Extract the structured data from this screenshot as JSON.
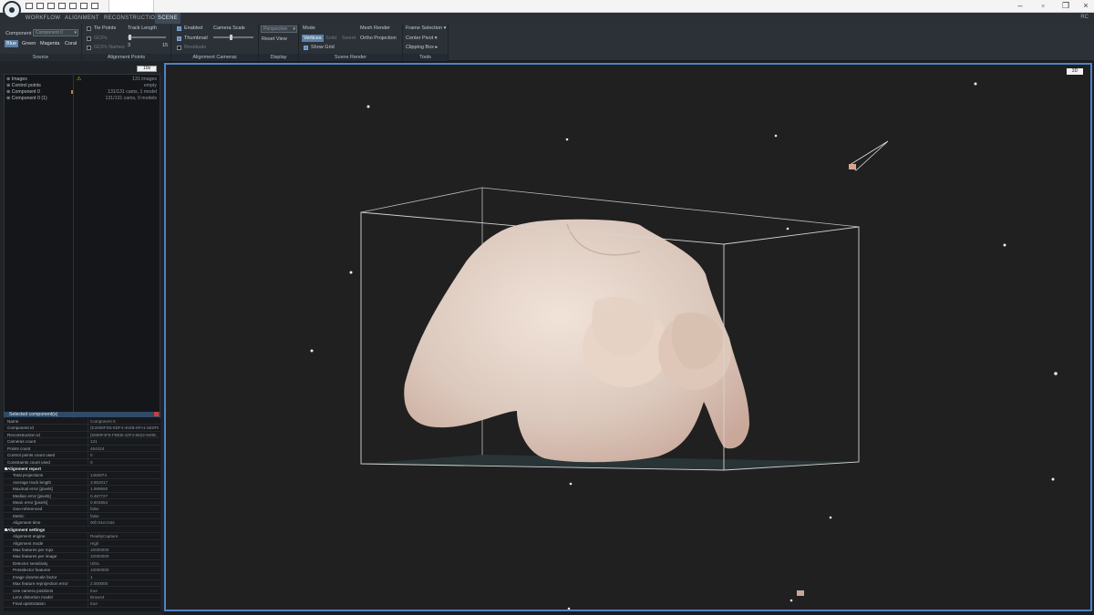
{
  "titlebar": {
    "tab_label": "",
    "winbtn_min": "–",
    "winbtn_max": "▫",
    "winbtn_close": "×"
  },
  "menu": {
    "tabs": [
      "WORKFLOW",
      "ALIGNMENT",
      "RECONSTRUCTION",
      "SCENE"
    ],
    "active": "SCENE",
    "user_badge": "RC"
  },
  "ribbon": {
    "source": {
      "title": "Source",
      "component_label": "Component",
      "component_value": "Component 0",
      "colors": [
        "Blue",
        "Green",
        "Magenta",
        "Coral"
      ],
      "active_color": "Blue"
    },
    "alignment_points": {
      "title": "Alignment Points",
      "tie_points": "Tie Points",
      "gcps": "GCPs",
      "gcp_names": "GCPs Names",
      "track_length": "Track Length",
      "track_min": "3",
      "track_max": "15"
    },
    "alignment_cameras": {
      "title": "Alignment Cameras",
      "enabled": "Enabled",
      "thumbnail": "Thumbnail",
      "residuals": "Residuals",
      "camera_scale": "Camera Scale"
    },
    "display": {
      "title": "Display",
      "projection_value": "Perspective",
      "reset_view": "Reset View"
    },
    "scene_render": {
      "title": "Scene Render",
      "mode_label": "Mode",
      "modes": [
        "Vertices",
        "Solid",
        "Sweet"
      ],
      "active_mode": "Vertices",
      "show_grid": "Show Grid",
      "mesh_render": "Mesh Render",
      "ortho_projection": "Ortho Projection"
    },
    "tools": {
      "title": "Tools",
      "frame_selection": "Frame Selection",
      "center_pivot": "Center Pivot",
      "clipping_box": "Clipping Box"
    }
  },
  "tree": {
    "filter_value": "10s",
    "items": [
      {
        "name": "Images",
        "value": "131 images"
      },
      {
        "name": "Control points",
        "value": "empty"
      },
      {
        "name": "Component 0",
        "value": "131/131 cams, 1 model"
      },
      {
        "name": "Component 0 (1)",
        "value": "131/131 cams, 0 models"
      }
    ]
  },
  "properties": {
    "title": "Selected component(s)",
    "rows": [
      {
        "k": "Name",
        "v": "Component 0"
      },
      {
        "k": "Component Id",
        "v": "{E2808FD6-9DF4-404B-9FA1-5E0F8..."
      },
      {
        "k": "Reconstruction Id",
        "v": "{5959F4F8-FBEB-42F4-8622-940E..."
      },
      {
        "k": "Cameras count",
        "v": "131"
      },
      {
        "k": "Points count",
        "v": "464424"
      },
      {
        "k": "Control points count used",
        "v": "0"
      },
      {
        "k": "Constraints count used",
        "v": "0"
      },
      {
        "k": "Alignment report",
        "v": "",
        "section": true
      },
      {
        "k": "Total projections",
        "v": "1482874",
        "sub": true
      },
      {
        "k": "Average track length",
        "v": "3.852017",
        "sub": true
      },
      {
        "k": "Maximal error [pixels]",
        "v": "1.999590",
        "sub": true
      },
      {
        "k": "Median error [pixels]",
        "v": "0.467727",
        "sub": true
      },
      {
        "k": "Mean error [pixels]",
        "v": "0.604654",
        "sub": true
      },
      {
        "k": "Geo-referenced",
        "v": "false",
        "sub": true
      },
      {
        "k": "Metric",
        "v": "false",
        "sub": true
      },
      {
        "k": "Alignment time",
        "v": "00h:01m:04s",
        "sub": true
      },
      {
        "k": "Alignment settings",
        "v": "",
        "section": true
      },
      {
        "k": "Alignment engine",
        "v": "RealityCapture",
        "sub": true
      },
      {
        "k": "Alignment mode",
        "v": "High",
        "sub": true
      },
      {
        "k": "Max features per mpx",
        "v": "10000000",
        "sub": true
      },
      {
        "k": "Max features per image",
        "v": "10000000",
        "sub": true
      },
      {
        "k": "Detector sensitivity",
        "v": "Ultra",
        "sub": true
      },
      {
        "k": "Preselector features",
        "v": "10000000",
        "sub": true
      },
      {
        "k": "Image downscale factor",
        "v": "1",
        "sub": true
      },
      {
        "k": "Max feature reprojection error",
        "v": "2.000000",
        "sub": true
      },
      {
        "k": "Use camera positions",
        "v": "true",
        "sub": true
      },
      {
        "k": "Lens distortion model",
        "v": "Brown4",
        "sub": true
      },
      {
        "k": "Final optimization",
        "v": "true",
        "sub": true
      }
    ]
  },
  "viewport": {
    "view_mode": "3D"
  },
  "colors": {
    "accent": "#4f82c8",
    "viewport_bg": "#202020",
    "mesh": "#e6d6cc",
    "bbox": "#c9c9c9"
  }
}
